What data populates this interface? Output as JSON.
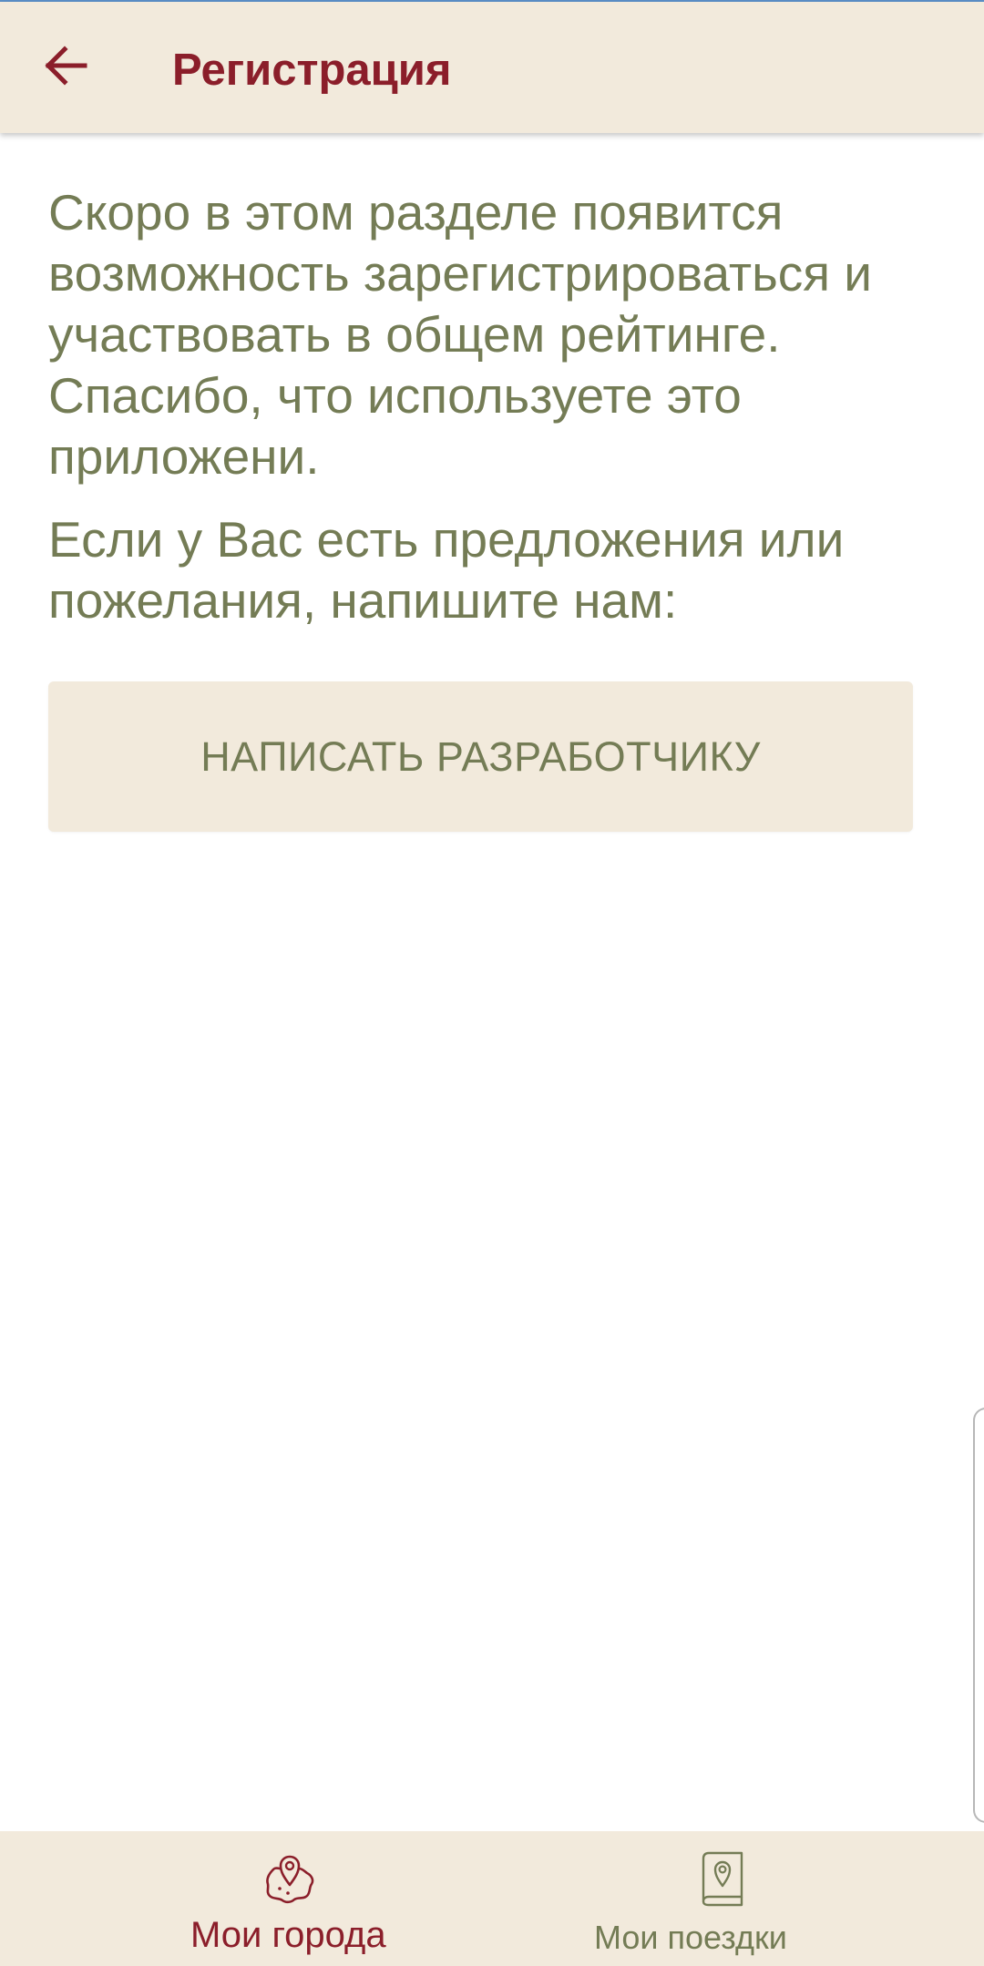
{
  "app_bar": {
    "title": "Регистрация",
    "back_icon": "arrow-left-icon"
  },
  "content": {
    "paragraph_1": "Скоро в этом разделе появится возможность зарегистрироваться и участвовать в общем рейтинге. Спасибо, что используете это приложени.",
    "paragraph_2": "Если у Вас есть предложения или пожелания, напишите нам:",
    "write_button_label": "НАПИСАТЬ РАЗРАБОТЧИКУ"
  },
  "bottom_nav": {
    "items": [
      {
        "label": "Мои города",
        "icon": "map-region-pin-icon",
        "active": true
      },
      {
        "label": "Мои поездки",
        "icon": "book-pin-icon",
        "active": false
      }
    ]
  },
  "colors": {
    "accent": "#8b1e2a",
    "text_olive": "#747c55",
    "bar_background": "#f2eadc"
  }
}
